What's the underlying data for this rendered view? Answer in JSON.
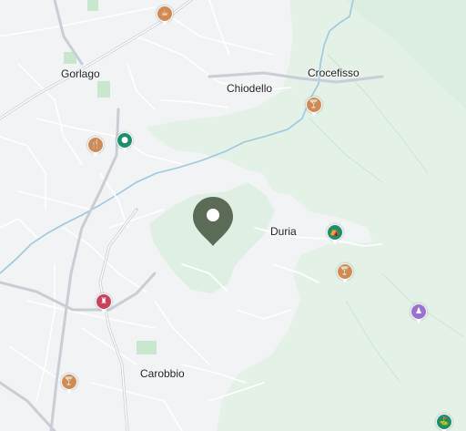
{
  "places": {
    "gorlago": "Gorlago",
    "chiodello": "Chiodello",
    "crocefisso": "Crocefisso",
    "duria": "Duria",
    "carobbio": "Carobbio"
  },
  "pois": [
    {
      "name": "cafe-icon",
      "glyph": "☕",
      "color": "#d08a52"
    },
    {
      "name": "bar-icon",
      "glyph": "🍸",
      "color": "#d08a52"
    },
    {
      "name": "restaurant-icon",
      "glyph": "🍴",
      "color": "#d08a52"
    },
    {
      "name": "park-icon",
      "glyph": "●",
      "color": "#1e8e6b"
    },
    {
      "name": "picnic-icon",
      "glyph": "⛺",
      "color": "#1e8e6b"
    },
    {
      "name": "bar-icon",
      "glyph": "🍸",
      "color": "#d08a52"
    },
    {
      "name": "museum-icon",
      "glyph": "♜",
      "color": "#c7435a"
    },
    {
      "name": "bar-icon",
      "glyph": "🍸",
      "color": "#d08a52"
    },
    {
      "name": "attraction-icon",
      "glyph": "♟",
      "color": "#9b72cf"
    },
    {
      "name": "golf-icon",
      "glyph": "⛳",
      "color": "#1e8e6b"
    }
  ],
  "colors": {
    "land": "#f1f3f4",
    "forest": "#e3f1e7",
    "forest_dark": "#d7ebdc",
    "park": "#c9e6cf",
    "water": "#9cc8e0",
    "road": "#ffffff",
    "major_road": "#c9ced6",
    "pin": "#5b6b55"
  }
}
